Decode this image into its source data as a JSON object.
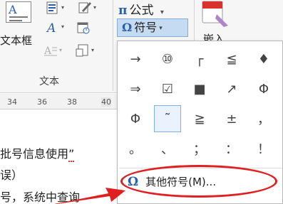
{
  "ribbon": {
    "textbox_label": "文本框",
    "textbox_icon_letter": "A",
    "formula_label": "公式",
    "formula_symbol": "π",
    "symbol_label": "符号",
    "symbol_icon": "Ω",
    "group_label": "文本",
    "embed_label": "嵌入",
    "dropdown_glyph": "▾"
  },
  "ruler": {
    "ticks": [
      "34",
      "36",
      "38",
      "40"
    ]
  },
  "document": {
    "line1": "批号信息使用",
    "line1_quote": "”",
    "line2": "误）",
    "line3": "号，系统中查询"
  },
  "symbol_panel": {
    "symbols": [
      "→",
      "⑩",
      "┌",
      "≦",
      "♦",
      "⇒",
      "☑",
      "■",
      "↗",
      "Φ",
      "Φ",
      "˜",
      "≧",
      "±",
      "，",
      "。",
      "、",
      "；",
      "：",
      "！"
    ],
    "selected_index": 11,
    "more_symbols_label": "其他符号(M)...",
    "more_symbols_icon": "Ω"
  },
  "colors": {
    "accent_blue": "#2a5ea8",
    "selection_blue": "#c5dbf1",
    "highlight_red": "#e02020"
  }
}
